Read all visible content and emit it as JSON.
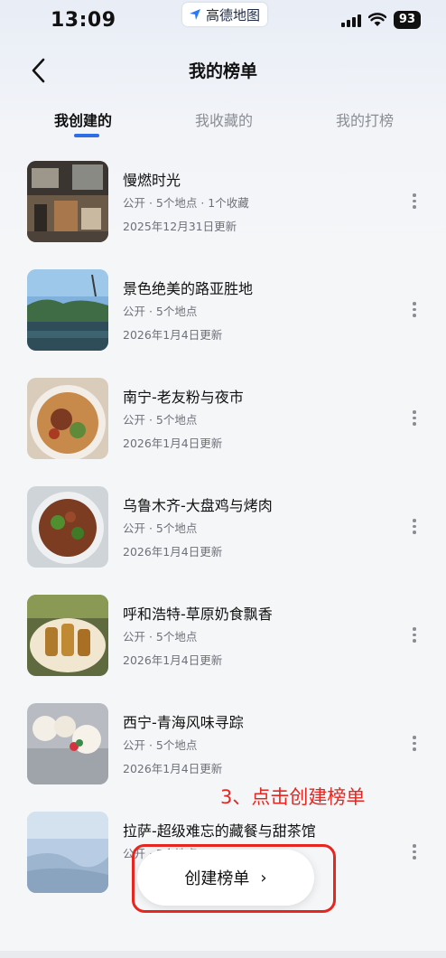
{
  "status_bar": {
    "time": "13:09",
    "app_name": "高德地图",
    "battery": "93"
  },
  "header": {
    "title": "我的榜单"
  },
  "tabs": [
    {
      "label": "我创建的",
      "active": true
    },
    {
      "label": "我收藏的",
      "active": false
    },
    {
      "label": "我的打榜",
      "active": false
    }
  ],
  "lists": [
    {
      "title": "慢燃时光",
      "meta": "公开 · 5个地点 · 1个收藏",
      "date": "2025年12月31日更新",
      "thumb": "cafe-interior"
    },
    {
      "title": "景色绝美的路亚胜地",
      "meta": "公开 · 5个地点",
      "date": "2026年1月4日更新",
      "thumb": "lake-landscape"
    },
    {
      "title": "南宁-老友粉与夜市",
      "meta": "公开 · 5个地点",
      "date": "2026年1月4日更新",
      "thumb": "noodle-bowl"
    },
    {
      "title": "乌鲁木齐-大盘鸡与烤肉",
      "meta": "公开 · 5个地点",
      "date": "2026年1月4日更新",
      "thumb": "chicken-plate"
    },
    {
      "title": "呼和浩特-草原奶食飘香",
      "meta": "公开 · 5个地点",
      "date": "2026年1月4日更新",
      "thumb": "fried-dish"
    },
    {
      "title": "西宁-青海风味寻踪",
      "meta": "公开 · 5个地点",
      "date": "2026年1月4日更新",
      "thumb": "steamed-buns"
    },
    {
      "title": "拉萨-超级难忘的藏餐与甜茶馆",
      "meta": "公开 · 5个地点",
      "date": "",
      "thumb": "sky-view"
    }
  ],
  "annotation": {
    "text": "3、点击创建榜单",
    "color": "#e8261f"
  },
  "create_button": {
    "label": "创建榜单",
    "chevron": "›"
  },
  "colors": {
    "accent": "#2f6de5",
    "annotation_red": "#e8261f"
  }
}
